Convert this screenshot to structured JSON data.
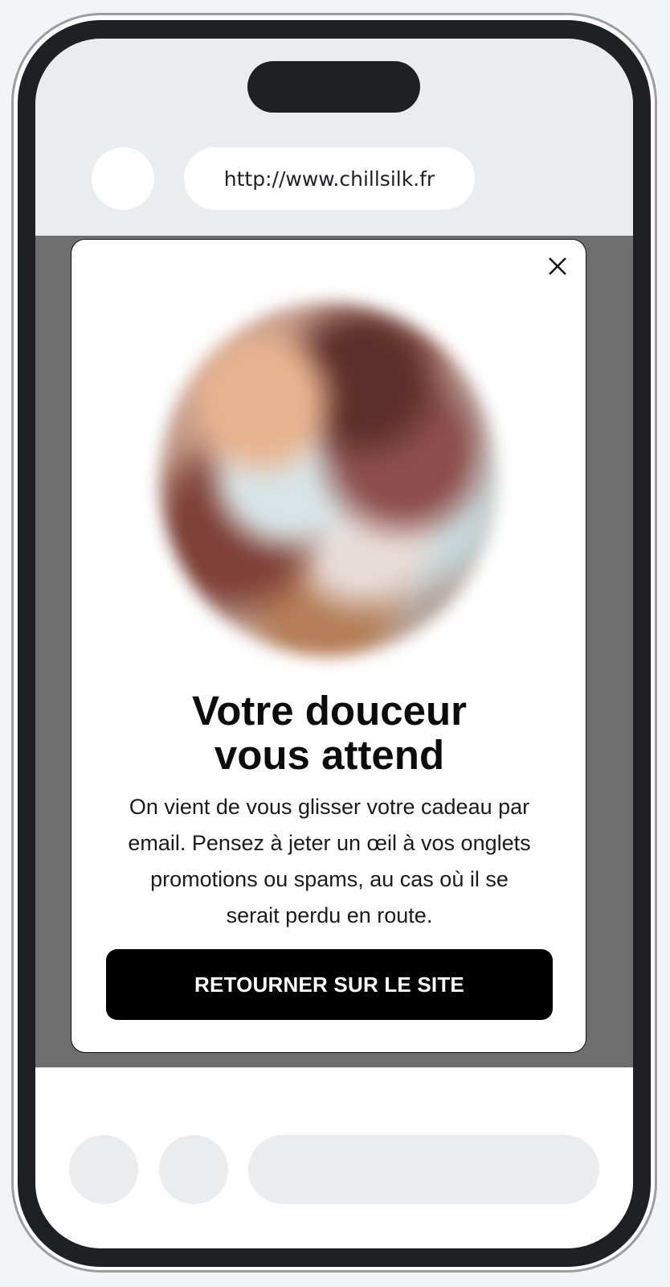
{
  "browser": {
    "url": "http://www.chillsilk.fr"
  },
  "modal": {
    "close_icon": "close-icon",
    "image_description": "blurred-circular-photo",
    "headline_line1": "Votre douceur",
    "headline_line2": "vous attend",
    "body_line1": "On vient de vous glisser votre cadeau par",
    "body_line2": "email. Pensez à jeter un œil à vos onglets",
    "body_line3": "promotions ou spams, au cas où il se",
    "body_line4": "serait perdu en route.",
    "button_label": "RETOURNER SUR LE SITE"
  },
  "colors": {
    "page_background": "#f3f4f6",
    "phone_frame": "#1f2023",
    "overlay": "#6e6e6e",
    "button": "#000000"
  }
}
